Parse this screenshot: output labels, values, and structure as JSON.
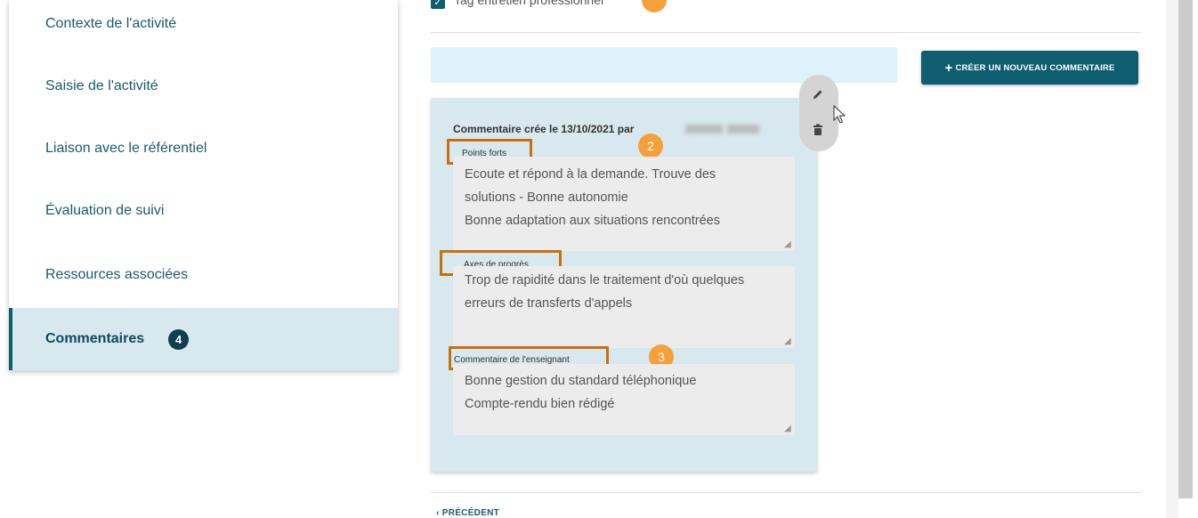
{
  "sidebar": {
    "items": [
      {
        "label": "Contexte de l'activité"
      },
      {
        "label": "Saisie de l'activité"
      },
      {
        "label": "Liaison avec le référentiel"
      },
      {
        "label": "Évaluation de suivi"
      },
      {
        "label": "Ressources associées"
      },
      {
        "label": "Commentaires",
        "badge": "4",
        "active": true
      }
    ]
  },
  "top": {
    "checkbox_label": "Tag entretien professionnel",
    "info_text": ""
  },
  "toolbar": {
    "create_label": "CRÉER UN NOUVEAU COMMENTAIRE"
  },
  "comment": {
    "header": "Commentaire crée le 13/10/2021 par",
    "fields": [
      {
        "label": "Points forts",
        "lines": [
          "Ecoute et répond à la demande. Trouve des",
          "solutions  - Bonne autonomie",
          "Bonne adaptation aux situations rencontrées"
        ]
      },
      {
        "label": "Axes de progrès",
        "lines": [
          "Trop de rapidité dans le traitement d'où quelques",
          "erreurs de transferts d'appels"
        ]
      },
      {
        "label": "Commentaire de l'enseignant",
        "lines": [
          "Bonne gestion du standard téléphonique",
          "Compte-rendu bien rédigé"
        ]
      }
    ]
  },
  "annotations": {
    "step2": "2",
    "step3": "3"
  },
  "footer": {
    "prev_label": "PRÉCÉDENT"
  },
  "colors": {
    "accent": "#0f5e6f",
    "highlight": "#c7700d",
    "annotation": "#f6a03c",
    "card_bg": "#d7e8ee"
  },
  "icons": [
    "check-icon",
    "plus-icon",
    "pencil-icon",
    "trash-icon",
    "cursor-icon",
    "chevron-left-icon"
  ]
}
